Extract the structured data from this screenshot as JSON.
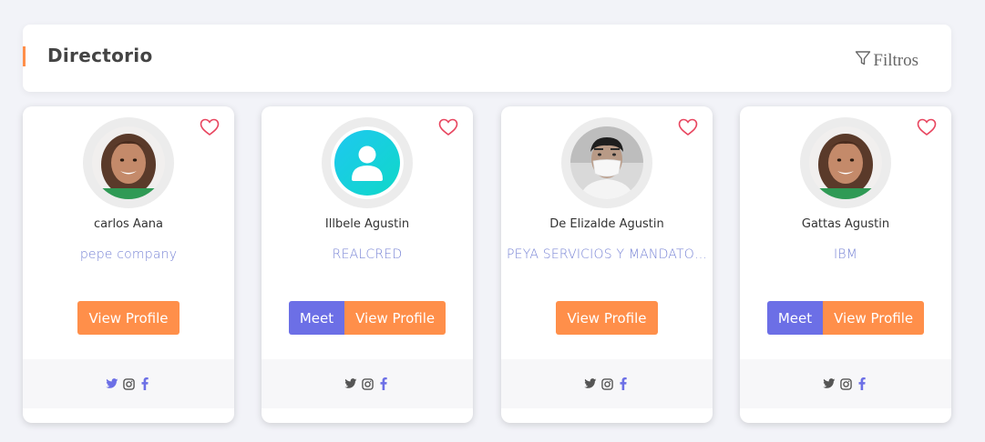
{
  "header": {
    "title": "Directorio",
    "filters_label": "Filtros"
  },
  "colors": {
    "accent": "#ff8f4a",
    "meet": "#6c6fe6",
    "company": "#7a86d6",
    "heart": "#e8455f"
  },
  "cards": [
    {
      "name": "carlos Aana",
      "company": "pepe company",
      "avatar": "child-photo",
      "has_meet": false,
      "view_label": "View Profile",
      "social_highlight": true
    },
    {
      "name": "Illbele Agustin",
      "company": "REALCRED",
      "avatar": "default-user-icon",
      "has_meet": true,
      "meet_label": "Meet",
      "view_label": "View Profile",
      "social_highlight": false
    },
    {
      "name": "De Elizalde Agustin",
      "company": "PEYA SERVICIOS Y MANDATOS...",
      "avatar": "masked-man-photo",
      "has_meet": false,
      "view_label": "View Profile",
      "social_highlight": false
    },
    {
      "name": "Gattas Agustin",
      "company": "IBM",
      "avatar": "child-photo",
      "has_meet": true,
      "meet_label": "Meet",
      "view_label": "View Profile",
      "social_highlight": false
    }
  ]
}
